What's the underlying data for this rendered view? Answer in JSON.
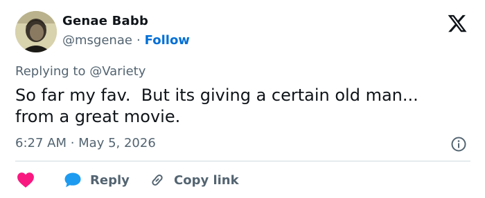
{
  "author": {
    "name": "Genae Babb",
    "handle": "@msgenae",
    "separator": "·",
    "follow_label": "Follow"
  },
  "reply_context": {
    "prefix": "Replying to",
    "mention": "@Variety"
  },
  "tweet": {
    "text": "So far my fav.  But its giving a certain old man...\nfrom a great movie."
  },
  "meta": {
    "timestamp": "6:27 AM · May 5, 2026"
  },
  "actions": {
    "reply_label": "Reply",
    "copy_label": "Copy link"
  },
  "icons": {
    "logo": "x-logo-icon",
    "info": "info-icon",
    "like": "heart-icon",
    "reply": "speech-bubble-icon",
    "copy": "link-icon"
  },
  "colors": {
    "accent": "#006fd6",
    "like": "#f91880",
    "reply_bubble": "#1d9bf0",
    "muted": "#536471",
    "text": "#0f1419",
    "divider": "#cfd9de"
  }
}
